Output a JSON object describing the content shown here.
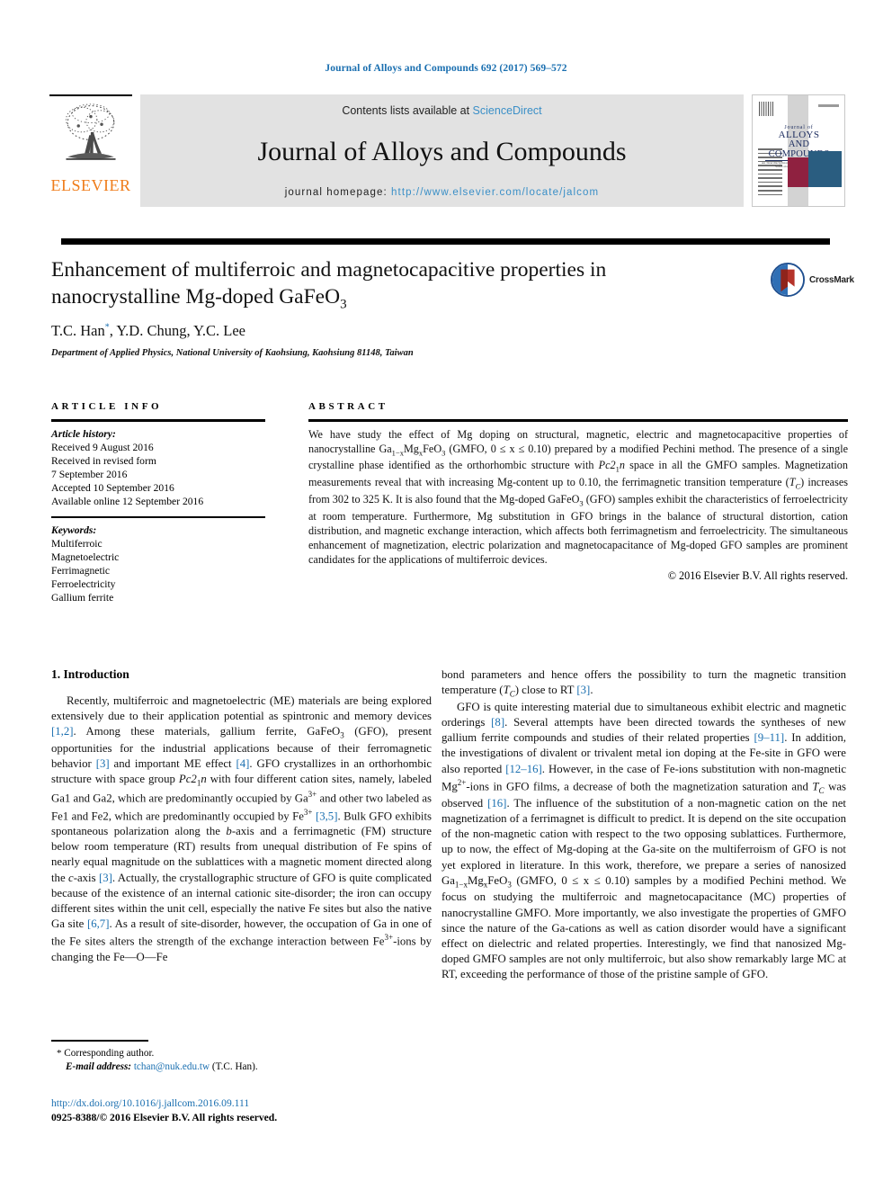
{
  "running_head": "Journal of Alloys and Compounds 692 (2017) 569–572",
  "masthead": {
    "publisher_name": "ELSEVIER",
    "contents_prefix": "Contents lists available at ",
    "contents_link": "ScienceDirect",
    "journal_name": "Journal of Alloys and Compounds",
    "homepage_prefix": "journal homepage: ",
    "homepage_url": "http://www.elsevier.com/locate/jalcom",
    "cover": {
      "line1": "Journal of",
      "line2": "ALLOYS",
      "line3": "AND COMPOUNDS",
      "sub": "An Interdisciplinary Journal of Materials Science and Solid-state Chemistry and Physics"
    }
  },
  "article": {
    "title_line1": "Enhancement of multiferroic and magnetocapacitive properties in",
    "title_line2_pre": "nanocrystalline Mg-doped GaFeO",
    "title_line2_sub": "3",
    "authors": "T.C. Han",
    "authors_rest": ", Y.D. Chung, Y.C. Lee",
    "author_star": "*",
    "affiliation": "Department of Applied Physics, National University of Kaohsiung, Kaohsiung 81148, Taiwan",
    "crossmark_label": "CrossMark"
  },
  "article_info": {
    "heading": "ARTICLE INFO",
    "history_label": "Article history:",
    "history": [
      "Received 9 August 2016",
      "Received in revised form",
      "7 September 2016",
      "Accepted 10 September 2016",
      "Available online 12 September 2016"
    ],
    "keywords_label": "Keywords:",
    "keywords": [
      "Multiferroic",
      "Magnetoelectric",
      "Ferrimagnetic",
      "Ferroelectricity",
      "Gallium ferrite"
    ]
  },
  "abstract": {
    "heading": "ABSTRACT",
    "p1_a": "We have study the effect of Mg doping on structural, magnetic, electric and magnetocapacitive properties of nanocrystalline Ga",
    "p1_sub1": "1−x",
    "p1_b": "Mg",
    "p1_sub2": "x",
    "p1_c": "FeO",
    "p1_sub3": "3",
    "p1_d": " (GMFO, 0 ≤ x ≤ 0.10) prepared by a modified Pechini method. The presence of a single crystalline phase identified as the orthorhombic structure with ",
    "p1_e_italic": "Pc2",
    "p1_sub4": "1",
    "p1_f_italic": "n",
    "p1_g": " space in all the GMFO samples. Magnetization measurements reveal that with increasing Mg-content up to 0.10, the ferrimagnetic transition temperature (",
    "p1_tc": "T",
    "p1_tc_sub": "C",
    "p1_h": ") increases from 302 to 325 K. It is also found that the Mg-doped GaFeO",
    "p1_sub5": "3",
    "p1_i": " (GFO) samples exhibit the characteristics of ferroelectricity at room temperature. Furthermore, Mg substitution in GFO brings in the balance of structural distortion, cation distribution, and magnetic exchange interaction, which affects both ferrimagnetism and ferroelectricity. The simultaneous enhancement of magnetization, electric polarization and magnetocapacitance of Mg-doped GFO samples are prominent candidates for the applications of multiferroic devices.",
    "copyright": "© 2016 Elsevier B.V. All rights reserved."
  },
  "body": {
    "section1_heading": "1. Introduction",
    "left_p1_a": "Recently, multiferroic and magnetoelectric (ME) materials are being explored extensively due to their application potential as spintronic and memory devices ",
    "left_p1_ref1": "[1,2]",
    "left_p1_b": ". Among these materials, gallium ferrite, GaFeO",
    "left_p1_sub1": "3",
    "left_p1_c": " (GFO), present opportunities for the industrial applications because of their ferromagnetic behavior ",
    "left_p1_ref2": "[3]",
    "left_p1_d": " and important ME effect ",
    "left_p1_ref3": "[4]",
    "left_p1_e": ". GFO crystallizes in an orthorhombic structure with space group ",
    "left_p1_italic1": "Pc2",
    "left_p1_sub2": "1",
    "left_p1_italic2": "n",
    "left_p1_f": " with four different cation sites, namely, labeled Ga1 and Ga2, which are predominantly occupied by Ga",
    "left_p1_sup1": "3+",
    "left_p1_g": " and other two labeled as Fe1 and Fe2, which are predominantly occupied by Fe",
    "left_p1_sup2": "3+",
    "left_p1_h": " ",
    "left_p1_ref4": "[3,5]",
    "left_p1_i": ". Bulk GFO exhibits spontaneous polarization along the ",
    "left_p1_italic3": "b",
    "left_p1_j": "-axis and a ferrimagnetic (FM) structure below room temperature (RT) results from unequal distribution of Fe spins of nearly equal magnitude on the sublattices with a magnetic moment directed along the ",
    "left_p1_italic4": "c",
    "left_p1_k": "-axis ",
    "left_p1_ref5": "[3]",
    "left_p1_l": ". Actually, the crystallographic structure of GFO is quite complicated because of the existence of an internal cationic site-disorder; the iron can occupy different sites within the unit cell, especially the native Fe sites but also the native Ga site ",
    "left_p1_ref6": "[6,7]",
    "left_p1_m": ". As a result of site-disorder, however, the occupation of Ga in one of the Fe sites alters the strength of the exchange interaction between Fe",
    "left_p1_sup3": "3+",
    "left_p1_n": "-ions by changing the Fe—O—Fe",
    "right_p1_a": "bond parameters and hence offers the possibility to turn the magnetic transition temperature (",
    "right_p1_tc": "T",
    "right_p1_tc_sub": "C",
    "right_p1_b": ") close to RT ",
    "right_p1_ref1": "[3]",
    "right_p1_c": ".",
    "right_p2_a": "GFO is quite interesting material due to simultaneous exhibit electric and magnetic orderings ",
    "right_p2_ref1": "[8]",
    "right_p2_b": ". Several attempts have been directed towards the syntheses of new gallium ferrite compounds and studies of their related properties ",
    "right_p2_ref2": "[9–11]",
    "right_p2_c": ". In addition, the investigations of divalent or trivalent metal ion doping at the Fe-site in GFO were also reported ",
    "right_p2_ref3": "[12–16]",
    "right_p2_d": ". However, in the case of Fe-ions substitution with non-magnetic Mg",
    "right_p2_sup1": "2+",
    "right_p2_e": "-ions in GFO films, a decrease of both the magnetization saturation and ",
    "right_p2_tc": "T",
    "right_p2_tc_sub": "C",
    "right_p2_f": " was observed ",
    "right_p2_ref4": "[16]",
    "right_p2_g": ". The influence of the substitution of a non-magnetic cation on the net magnetization of a ferrimagnet is difficult to predict. It is depend on the site occupation of the non-magnetic cation with respect to the two opposing sublattices. Furthermore, up to now, the effect of Mg-doping at the Ga-site on the multiferroism of GFO is not yet explored in literature. In this work, therefore, we prepare a series of nanosized Ga",
    "right_p2_sub1": "1−x",
    "right_p2_h": "Mg",
    "right_p2_sub2": "x",
    "right_p2_i": "FeO",
    "right_p2_sub3": "3",
    "right_p2_j": " (GMFO, 0 ≤ x ≤ 0.10) samples by a modified Pechini method. We focus on studying the multiferroic and magnetocapacitance (MC) properties of nanocrystalline GMFO. More importantly, we also investigate the properties of GMFO since the nature of the Ga-cations as well as cation disorder would have a significant effect on dielectric and related properties. Interestingly, we find that nanosized Mg-doped GMFO samples are not only multiferroic, but also show remarkably large MC at RT, exceeding the performance of those of the pristine sample of GFO."
  },
  "footer": {
    "star": "*",
    "corresponding": " Corresponding author.",
    "email_label": "E-mail address:",
    "email": "tchan@nuk.edu.tw",
    "email_owner": " (T.C. Han).",
    "doi": "http://dx.doi.org/10.1016/j.jallcom.2016.09.111",
    "issn_line": "0925-8388/© 2016 Elsevier B.V. All rights reserved."
  },
  "colors": {
    "link_blue": "#1a6fb0",
    "elsevier_orange": "#ef7c1a",
    "banner_grey": "#e2e2e2",
    "cover_red": "#8f2140",
    "cover_blue": "#2a5d80"
  }
}
